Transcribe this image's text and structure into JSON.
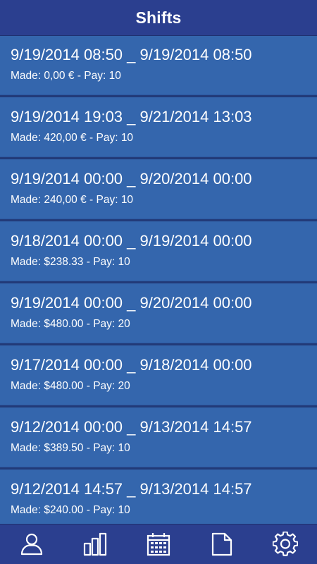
{
  "header": {
    "title": "Shifts"
  },
  "shifts": [
    {
      "range": "9/19/2014 08:50 _ 9/19/2014 08:50",
      "details": "Made: 0,00 € - Pay: 10"
    },
    {
      "range": "9/19/2014 19:03 _ 9/21/2014 13:03",
      "details": "Made: 420,00 € - Pay: 10"
    },
    {
      "range": "9/19/2014 00:00 _ 9/20/2014 00:00",
      "details": "Made: 240,00 € - Pay: 10"
    },
    {
      "range": "9/18/2014 00:00 _ 9/19/2014 00:00",
      "details": "Made: $238.33 - Pay: 10"
    },
    {
      "range": "9/19/2014 00:00 _ 9/20/2014 00:00",
      "details": "Made: $480.00 - Pay: 20"
    },
    {
      "range": "9/17/2014 00:00 _ 9/18/2014 00:00",
      "details": "Made: $480.00 - Pay: 20"
    },
    {
      "range": "9/12/2014 00:00 _ 9/13/2014 14:57",
      "details": "Made: $389.50 - Pay: 10"
    },
    {
      "range": "9/12/2014 14:57 _ 9/13/2014 14:57",
      "details": "Made: $240.00 - Pay: 10"
    }
  ],
  "tabbar": {
    "tabs": [
      {
        "icon": "user-icon"
      },
      {
        "icon": "bar-chart-icon"
      },
      {
        "icon": "calendar-icon"
      },
      {
        "icon": "document-icon"
      },
      {
        "icon": "gear-icon"
      }
    ]
  },
  "colors": {
    "header_bg": "#2b3f8f",
    "row_bg": "#3466ad",
    "separator": "#223a78",
    "text": "#ffffff"
  }
}
